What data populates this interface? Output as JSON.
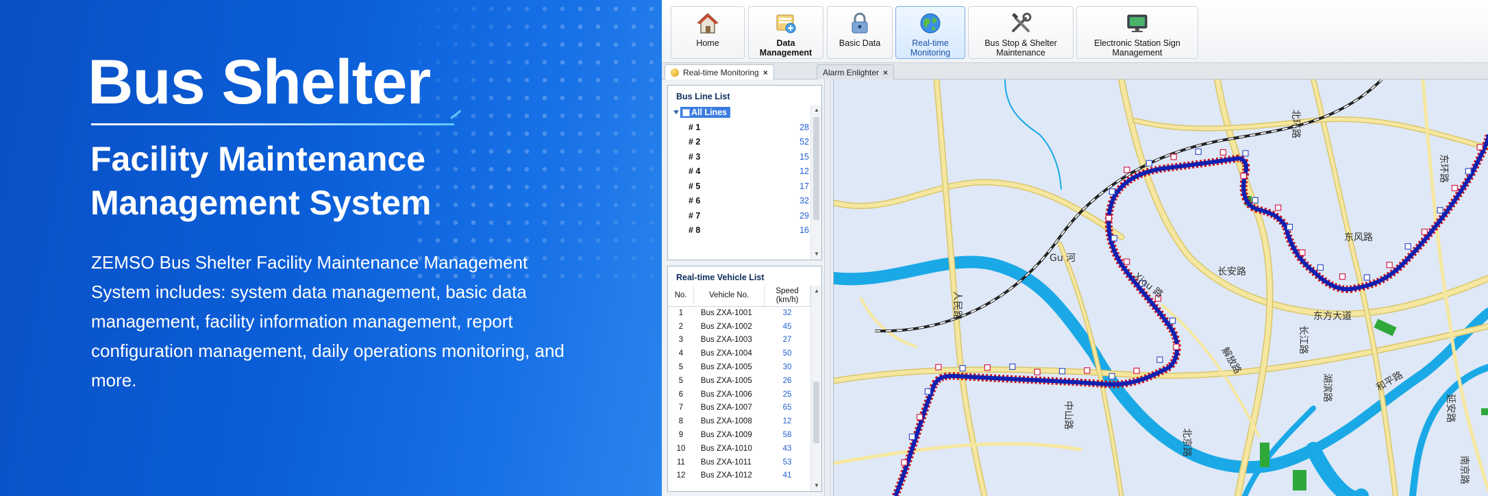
{
  "hero": {
    "title": "Bus Shelter",
    "subtitle_line1": "Facility Maintenance",
    "subtitle_line2": "Management System",
    "description": "ZEMSO Bus Shelter Facility Maintenance Management System includes: system data management, basic data management, facility information management, report configuration management, daily operations monitoring, and more."
  },
  "toolbar": {
    "buttons": [
      {
        "label": "Home",
        "icon": "home-icon"
      },
      {
        "label": "Data Management",
        "icon": "database-icon"
      },
      {
        "label": "Basic Data",
        "icon": "lock-icon"
      },
      {
        "label": "Real-time Monitoring",
        "icon": "globe-icon",
        "active": true
      },
      {
        "label": "Bus Stop & Shelter Maintenance",
        "icon": "tools-icon"
      },
      {
        "label": "Electronic Station Sign Management",
        "icon": "monitor-icon"
      }
    ]
  },
  "tabs": [
    {
      "label": "Real-time Monitoring",
      "close": "×",
      "active": true
    },
    {
      "label": "Alarm Enlighter",
      "close": "×",
      "active": false
    }
  ],
  "bus_line_list": {
    "title": "Bus Line List",
    "all_label": "All Lines",
    "lines": [
      {
        "name": "# 1",
        "count": "28"
      },
      {
        "name": "# 2",
        "count": "52"
      },
      {
        "name": "# 3",
        "count": "15"
      },
      {
        "name": "# 4",
        "count": "12"
      },
      {
        "name": "# 5",
        "count": "17"
      },
      {
        "name": "# 6",
        "count": "32"
      },
      {
        "name": "# 7",
        "count": "29"
      },
      {
        "name": "# 8",
        "count": "16"
      }
    ]
  },
  "vehicle_list": {
    "title": "Real-time Vehicle List",
    "columns": [
      "No.",
      "Vehicle No.",
      "Speed (km/h)"
    ],
    "rows": [
      [
        "1",
        "Bus ZXA-1001",
        "32"
      ],
      [
        "2",
        "Bus ZXA-1002",
        "45"
      ],
      [
        "3",
        "Bus ZXA-1003",
        "27"
      ],
      [
        "4",
        "Bus ZXA-1004",
        "50"
      ],
      [
        "5",
        "Bus ZXA-1005",
        "30"
      ],
      [
        "5",
        "Bus ZXA-1005",
        "26"
      ],
      [
        "6",
        "Bus ZXA-1006",
        "25"
      ],
      [
        "7",
        "Bus ZXA-1007",
        "65"
      ],
      [
        "8",
        "Bus ZXA-1008",
        "12"
      ],
      [
        "9",
        "Bus ZXA-1009",
        "58"
      ],
      [
        "10",
        "Bus ZXA-1010",
        "43"
      ],
      [
        "11",
        "Bus ZXA-1011",
        "53"
      ],
      [
        "12",
        "Bus ZXA-1012",
        "41"
      ]
    ]
  },
  "map": {
    "labels": [
      "北环路",
      "东环路",
      "Gu 河",
      "Xiou 路",
      "人民路",
      "解放路",
      "长江路",
      "中山路",
      "东方大道",
      "和平路",
      "延安路",
      "北京路",
      "南京路",
      "东风路",
      "长安路",
      "湖滨路"
    ],
    "colors": {
      "route_outer": "#c8121a",
      "route_inner": "#1020b0",
      "water": "#1aa9e6",
      "road": "#f5e7a0",
      "road_edge": "#d9c56a",
      "land": "#dfe8f6",
      "green": "#2fa83a"
    }
  }
}
